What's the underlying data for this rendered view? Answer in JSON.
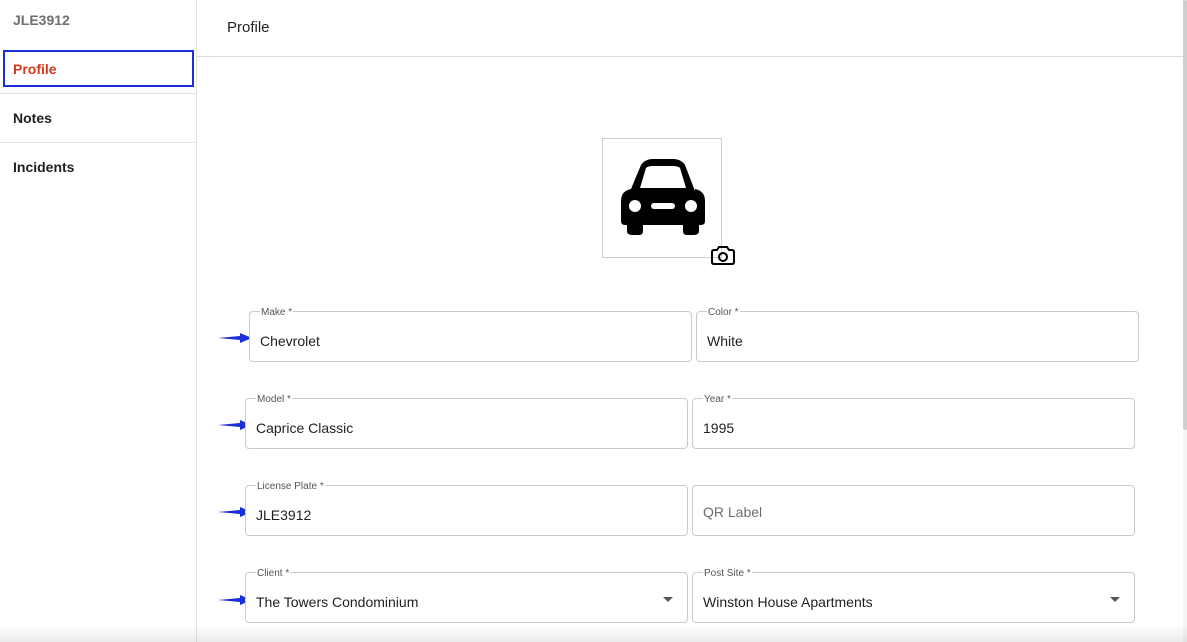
{
  "sidebar": {
    "title": "JLE3912",
    "items": [
      {
        "label": "Profile",
        "active": true
      },
      {
        "label": "Notes"
      },
      {
        "label": "Incidents"
      }
    ]
  },
  "header": {
    "title": "Profile"
  },
  "photo": {
    "icon": "car-icon",
    "upload_icon": "camera-icon"
  },
  "form": {
    "make": {
      "label": "Make *",
      "value": "Chevrolet"
    },
    "color": {
      "label": "Color *",
      "value": "White"
    },
    "model": {
      "label": "Model *",
      "value": "Caprice Classic"
    },
    "year": {
      "label": "Year *",
      "value": "1995"
    },
    "license_plate": {
      "label": "License Plate *",
      "value": "JLE3912"
    },
    "qr_label": {
      "placeholder": "QR Label"
    },
    "client": {
      "label": "Client *",
      "value": "The Towers Condominium"
    },
    "post_site": {
      "label": "Post Site *",
      "value": "Winston House Apartments"
    }
  },
  "colors": {
    "active_item": "#d23a1e",
    "highlight_border": "#1c2fd6",
    "annotation_arrow": "#1c2fd6"
  }
}
